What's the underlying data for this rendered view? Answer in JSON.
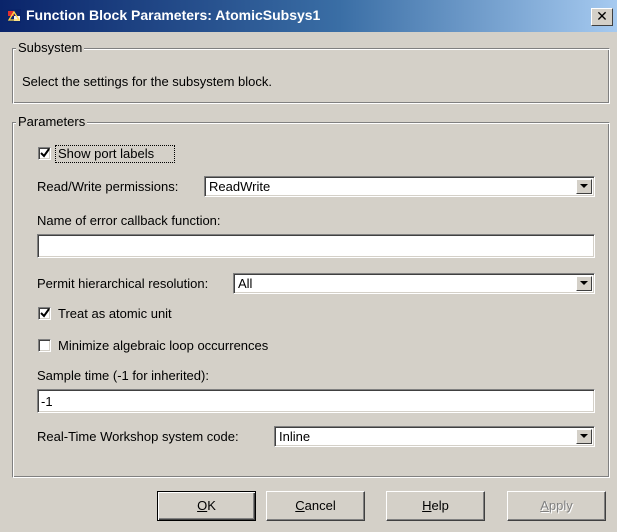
{
  "window": {
    "title": "Function Block Parameters: AtomicSubsys1",
    "close_glyph": "✕"
  },
  "subsystem": {
    "legend": "Subsystem",
    "description": "Select the settings for the subsystem block."
  },
  "parameters": {
    "legend": "Parameters",
    "show_port_labels": {
      "label": "Show port labels",
      "checked": true
    },
    "read_write_permissions": {
      "label": "Read/Write permissions:",
      "value": "ReadWrite"
    },
    "error_callback": {
      "label": "Name of error callback function:",
      "value": ""
    },
    "hierarchical_resolution": {
      "label": "Permit hierarchical resolution:",
      "value": "All"
    },
    "treat_atomic": {
      "label": "Treat as atomic unit",
      "checked": true
    },
    "minimize_loop": {
      "label": "Minimize algebraic loop occurrences",
      "checked": false
    },
    "sample_time": {
      "label": "Sample time (-1 for inherited):",
      "value": "-1"
    },
    "rtw_system_code": {
      "label": "Real-Time Workshop system code:",
      "value": "Inline"
    }
  },
  "buttons": {
    "ok": {
      "mnemonic": "O",
      "rest": "K"
    },
    "cancel": {
      "mnemonic": "C",
      "rest": "ancel"
    },
    "help": {
      "mnemonic": "H",
      "rest": "elp"
    },
    "apply": {
      "mnemonic": "A",
      "rest": "pply",
      "enabled": false
    }
  },
  "icons": {
    "title": "simulink-block-icon",
    "close": "close-icon",
    "dropdown": "chevron-down-icon",
    "check": "checkmark-icon"
  },
  "colors": {
    "titlebar_start": "#0a246a",
    "titlebar_end": "#a6caf0",
    "dialog_face": "#d4d0c8"
  }
}
